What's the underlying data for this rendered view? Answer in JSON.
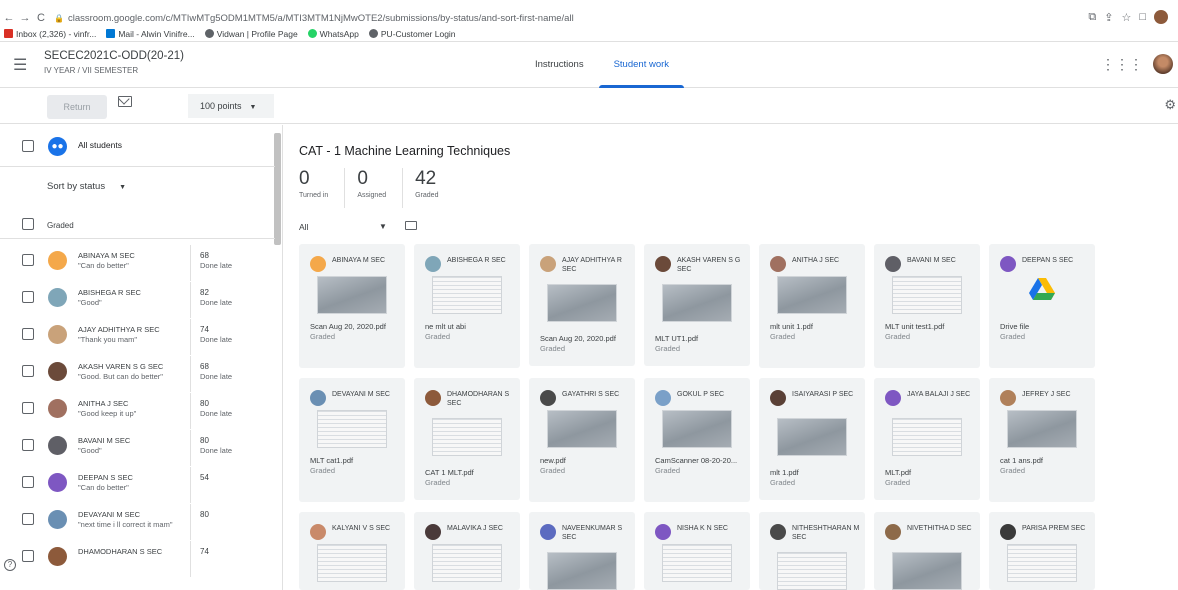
{
  "browser": {
    "url": "classroom.google.com/c/MTIwMTg5ODM1MTM5/a/MTI3MTM1NjMwOTE2/submissions/by-status/and-sort-first-name/all",
    "bookmarks": [
      "Inbox (2,326) - vinfr...",
      "Mail - Alwin Vinifre...",
      "Vidwan | Profile Page",
      "WhatsApp",
      "PU-Customer Login"
    ]
  },
  "header": {
    "class_title": "SECEC2021C-ODD(20-21)",
    "class_subtitle": "IV YEAR / VII SEMESTER",
    "tab_instructions": "Instructions",
    "tab_student_work": "Student work"
  },
  "toolbar": {
    "return_label": "Return",
    "points_label": "100 points"
  },
  "sidebar": {
    "all_students": "All students",
    "sort_label": "Sort by status",
    "graded_label": "Graded",
    "students": [
      {
        "name": "ABINAYA M SEC",
        "comment": "\"Can do better\"",
        "score": "68",
        "status": "Done late",
        "color": "#f4a84a"
      },
      {
        "name": "ABISHEGA R SEC",
        "comment": "\"Good\"",
        "score": "82",
        "status": "Done late",
        "color": "#7fa6b8"
      },
      {
        "name": "AJAY ADHITHYA R SEC",
        "comment": "\"Thank you mam\"",
        "score": "74",
        "status": "Done late",
        "color": "#c9a27a"
      },
      {
        "name": "AKASH VAREN S G SEC",
        "comment": "\"Good. But can do better\"",
        "score": "68",
        "status": "Done late",
        "color": "#6b4a3a"
      },
      {
        "name": "ANITHA J SEC",
        "comment": "\"Good keep it up\"",
        "score": "80",
        "status": "Done late",
        "color": "#a07060"
      },
      {
        "name": "BAVANI M SEC",
        "comment": "\"Good\"",
        "score": "80",
        "status": "Done late",
        "color": "#5f5f66"
      },
      {
        "name": "DEEPAN S SEC",
        "comment": "\"Can do better\"",
        "score": "54",
        "status": "",
        "color": "#7e57c2"
      },
      {
        "name": "DEVAYANI M SEC",
        "comment": "\"next time i ll correct it mam\"",
        "score": "80",
        "status": "",
        "color": "#6a8fb3"
      },
      {
        "name": "DHAMODHARAN S SEC",
        "comment": "",
        "score": "74",
        "status": "",
        "color": "#8d5a3b"
      }
    ]
  },
  "main": {
    "assignment_title": "CAT - 1 Machine Learning Techniques",
    "stats": [
      {
        "num": "0",
        "label": "Turned in"
      },
      {
        "num": "0",
        "label": "Assigned"
      },
      {
        "num": "42",
        "label": "Graded"
      }
    ],
    "filter_label": "All",
    "cards": [
      {
        "name": "ABINAYA M SEC",
        "file": "Scan Aug 20, 2020.pdf",
        "status": "Graded",
        "color": "#f4a84a",
        "thumb": "dark"
      },
      {
        "name": "ABISHEGA R SEC",
        "file": "ne mlt ut abi",
        "status": "Graded",
        "color": "#7fa6b8",
        "thumb": "light"
      },
      {
        "name": "AJAY ADHITHYA R SEC",
        "file": "Scan Aug 20, 2020.pdf",
        "status": "Graded",
        "color": "#c9a27a",
        "thumb": "dark"
      },
      {
        "name": "AKASH VAREN S G SEC",
        "file": "MLT UT1.pdf",
        "status": "Graded",
        "color": "#6b4a3a",
        "thumb": "dark"
      },
      {
        "name": "ANITHA J SEC",
        "file": "mlt unit 1.pdf",
        "status": "Graded",
        "color": "#a07060",
        "thumb": "dark"
      },
      {
        "name": "BAVANI M SEC",
        "file": "MLT unit test1.pdf",
        "status": "Graded",
        "color": "#5f5f66",
        "thumb": "light"
      },
      {
        "name": "DEEPAN S SEC",
        "file": "Drive file",
        "status": "Graded",
        "color": "#7e57c2",
        "thumb": "drive"
      },
      {
        "name": "DEVAYANI M SEC",
        "file": "MLT cat1.pdf",
        "status": "Graded",
        "color": "#6a8fb3",
        "thumb": "light"
      },
      {
        "name": "DHAMODHARAN S SEC",
        "file": "CAT 1 MLT.pdf",
        "status": "Graded",
        "color": "#8d5a3b",
        "thumb": "light"
      },
      {
        "name": "GAYATHRI S SEC",
        "file": "new.pdf",
        "status": "Graded",
        "color": "#4a4a4a",
        "thumb": "dark"
      },
      {
        "name": "GOKUL P SEC",
        "file": "CamScanner 08-20-20...",
        "status": "Graded",
        "color": "#7aa0c8",
        "thumb": "dark"
      },
      {
        "name": "ISAIYARASI P SEC",
        "file": "mlt 1.pdf",
        "status": "Graded",
        "color": "#5a4036",
        "thumb": "dark"
      },
      {
        "name": "JAYA BALAJI J SEC",
        "file": "MLT.pdf",
        "status": "Graded",
        "color": "#7e57c2",
        "thumb": "light"
      },
      {
        "name": "JEFREY J SEC",
        "file": "cat 1 ans.pdf",
        "status": "Graded",
        "color": "#b0805a",
        "thumb": "dark"
      },
      {
        "name": "KALYANI V S SEC",
        "file": "",
        "status": "",
        "color": "#c98a6a",
        "thumb": "light"
      },
      {
        "name": "MALAVIKA J SEC",
        "file": "",
        "status": "",
        "color": "#4a3a3a",
        "thumb": "light"
      },
      {
        "name": "NAVEENKUMAR S SEC",
        "file": "",
        "status": "",
        "color": "#5c6bc0",
        "thumb": "dark"
      },
      {
        "name": "NISHA K N SEC",
        "file": "",
        "status": "",
        "color": "#7e57c2",
        "thumb": "light"
      },
      {
        "name": "NITHESHTHARAN M SEC",
        "file": "",
        "status": "",
        "color": "#4a4a4a",
        "thumb": "light"
      },
      {
        "name": "NIVETHITHA D SEC",
        "file": "",
        "status": "",
        "color": "#8d6a4a",
        "thumb": "dark"
      },
      {
        "name": "PARISA PREM SEC",
        "file": "",
        "status": "",
        "color": "#3a3a3a",
        "thumb": "light"
      }
    ]
  }
}
